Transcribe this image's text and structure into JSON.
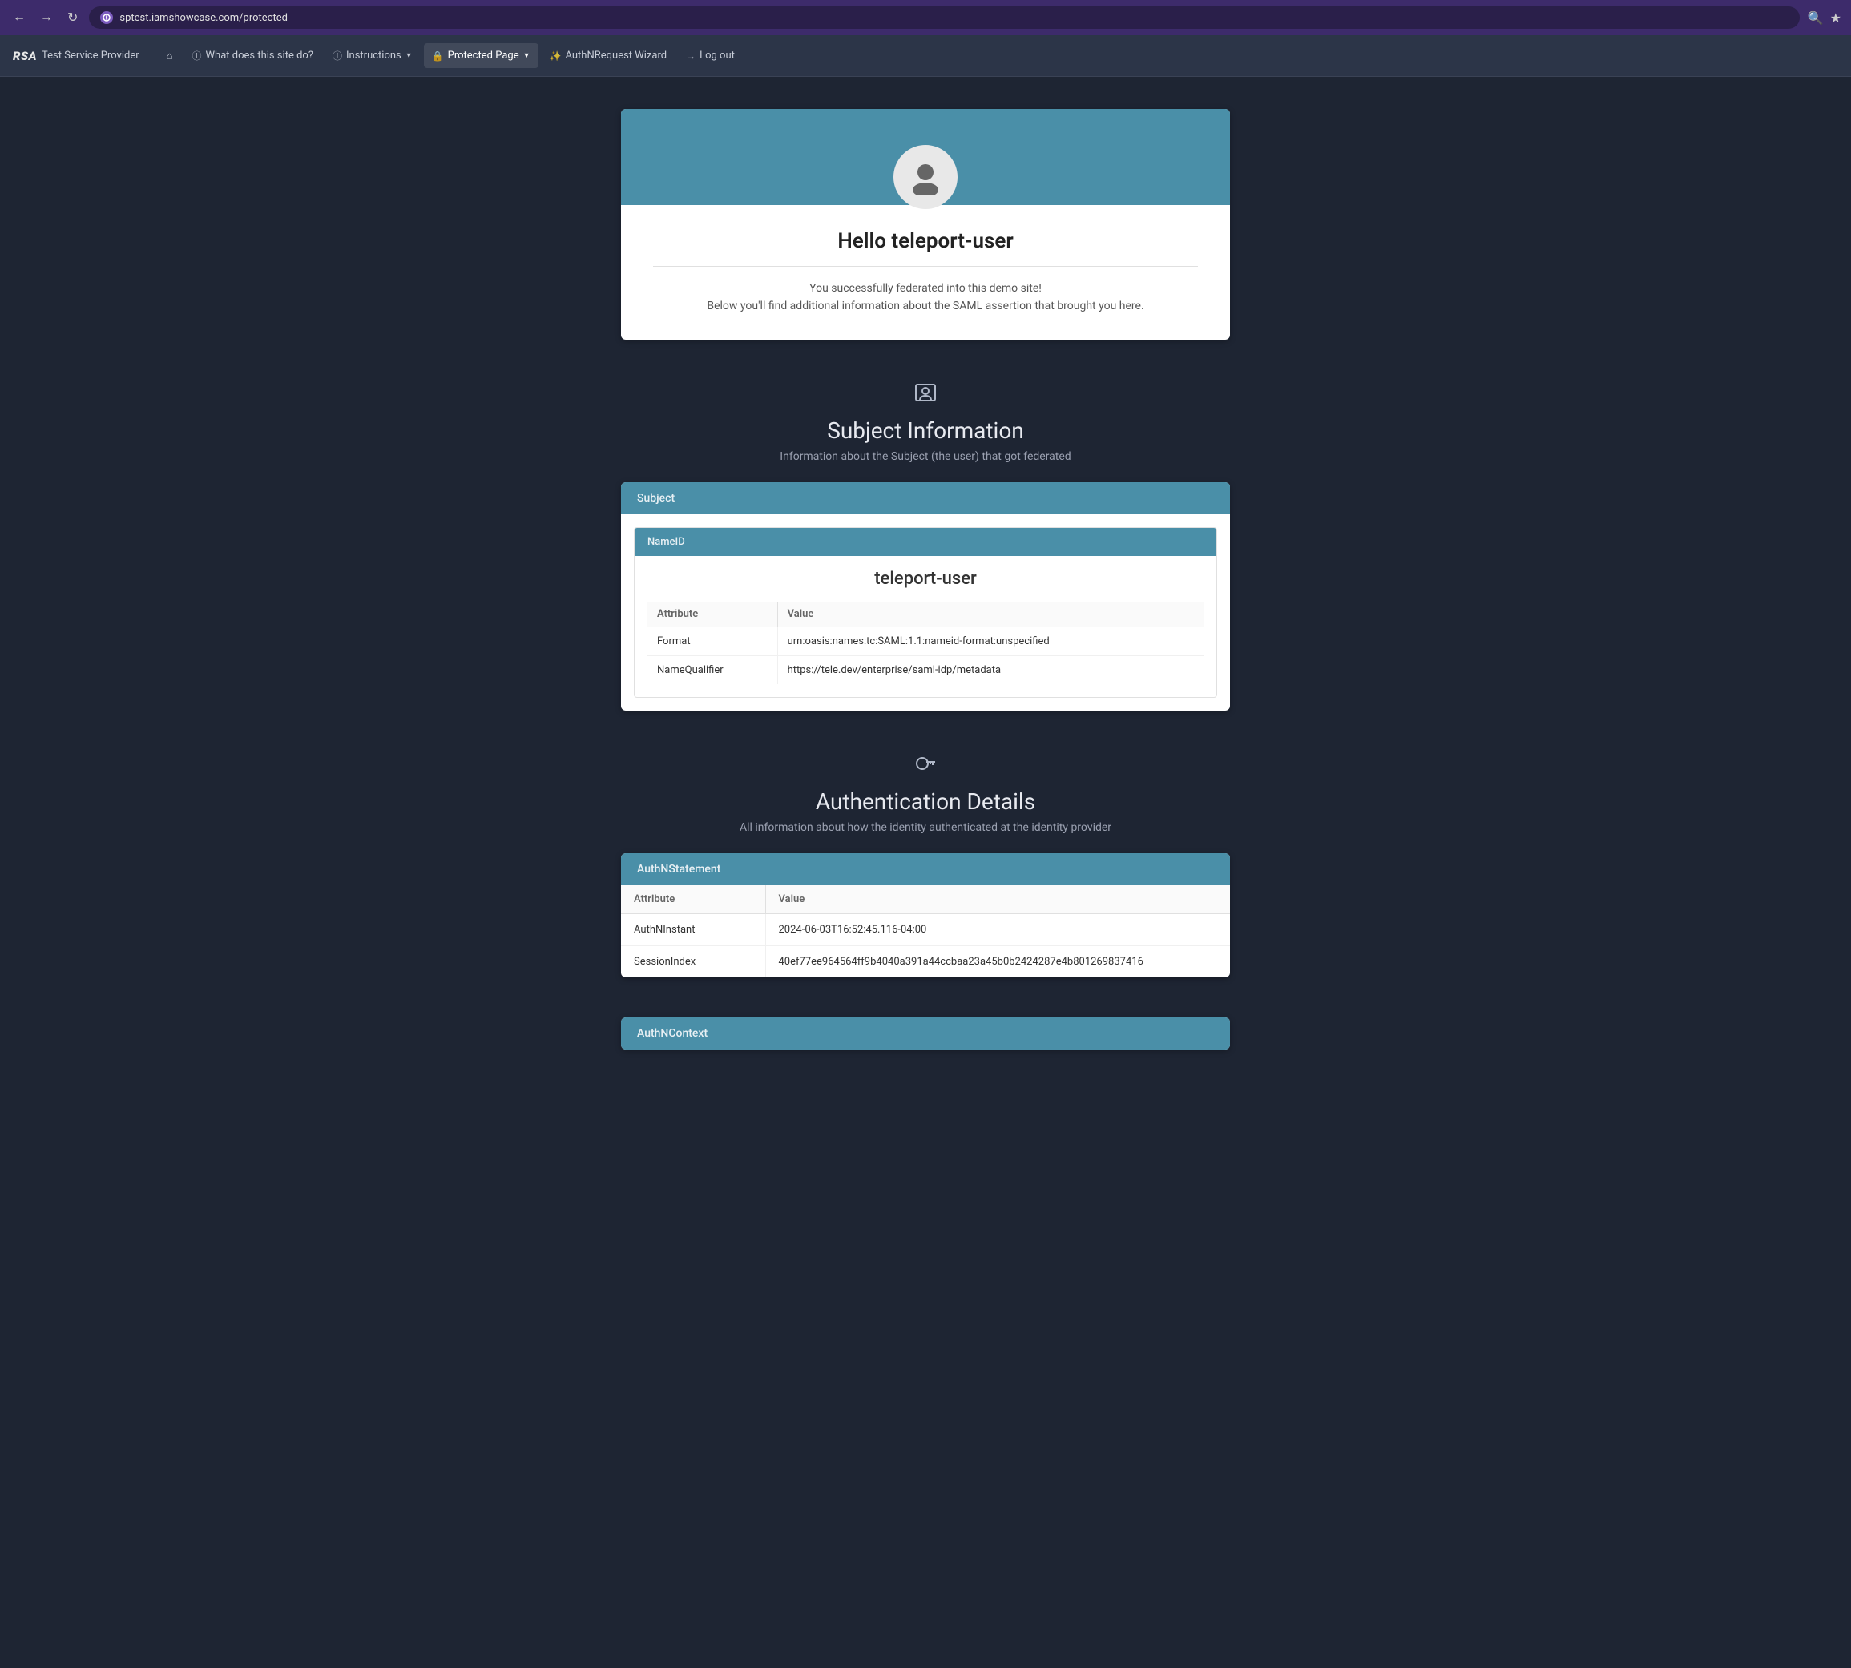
{
  "browser": {
    "url": "sptest.iamshowcase.com/protected",
    "favicon": "🔒"
  },
  "nav": {
    "brand": "RSA",
    "service_name": "Test Service Provider",
    "items": [
      {
        "id": "home",
        "label": "🏠",
        "icon": "home-icon",
        "type": "icon"
      },
      {
        "id": "what",
        "label": "What does this site do?",
        "icon": "info-icon",
        "has_caret": false
      },
      {
        "id": "instructions",
        "label": "Instructions",
        "icon": "info-icon",
        "has_caret": true
      },
      {
        "id": "protected",
        "label": "Protected Page",
        "icon": "lock-icon",
        "has_caret": true,
        "active": true
      },
      {
        "id": "wizard",
        "label": "AuthNRequest Wizard",
        "icon": "wand-icon",
        "has_caret": false
      },
      {
        "id": "logout",
        "label": "Log out",
        "icon": "logout-icon",
        "has_caret": false
      }
    ]
  },
  "welcome": {
    "greeting": "Hello teleport-user",
    "line1": "You successfully federated into this demo site!",
    "line2": "Below you'll find additional information about the SAML assertion that brought you here."
  },
  "subject_section": {
    "icon": "contact-card-icon",
    "title": "Subject Information",
    "subtitle": "Information about the Subject (the user) that got federated",
    "card_header": "Subject",
    "nameid_header": "NameID",
    "nameid_value": "teleport-user",
    "attributes": {
      "col1": "Attribute",
      "col2": "Value",
      "rows": [
        {
          "attribute": "Format",
          "value": "urn:oasis:names:tc:SAML:1.1:nameid-format:unspecified"
        },
        {
          "attribute": "NameQualifier",
          "value": "https://tele.dev/enterprise/saml-idp/metadata"
        }
      ]
    }
  },
  "auth_section": {
    "icon": "key-icon",
    "title": "Authentication Details",
    "subtitle": "All information about how the identity authenticated at the identity provider",
    "card_header": "AuthNStatement",
    "table": {
      "col1": "Attribute",
      "col2": "Value",
      "rows": [
        {
          "attribute": "AuthNInstant",
          "value": "2024-06-03T16:52:45.116-04:00"
        },
        {
          "attribute": "SessionIndex",
          "value": "40ef77ee964564ff9b4040a391a44ccbaa23a45b0b2424287e4b801269837416"
        }
      ]
    },
    "authn_context_header": "AuthNContext"
  }
}
